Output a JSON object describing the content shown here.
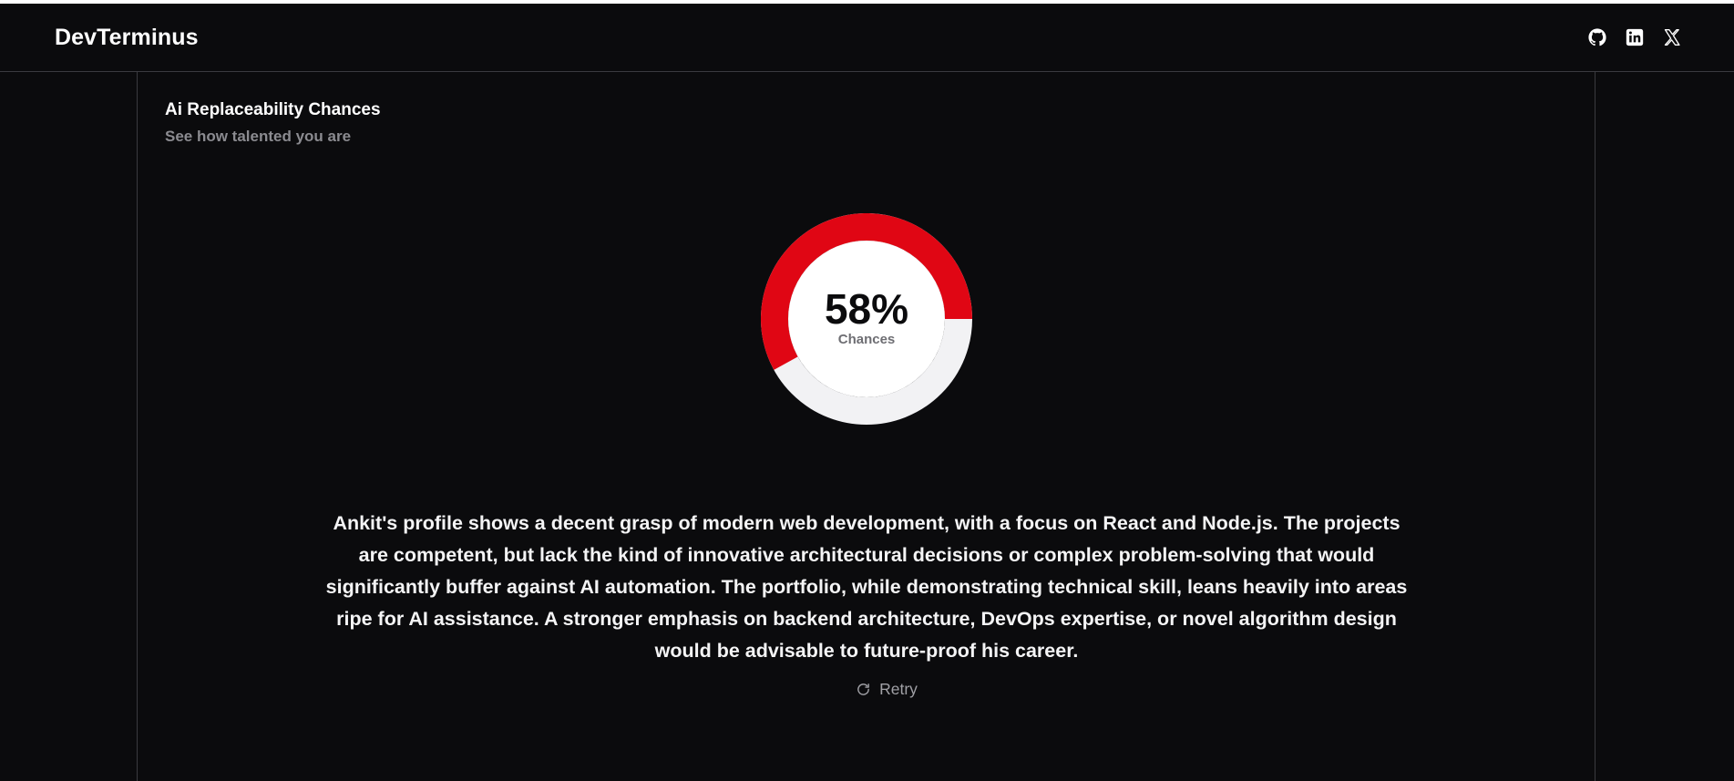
{
  "header": {
    "brand": "DevTerminus",
    "icons": [
      {
        "name": "github-icon"
      },
      {
        "name": "linkedin-icon"
      },
      {
        "name": "x-icon"
      }
    ]
  },
  "section": {
    "title": "Ai Replaceability Chances",
    "subtitle": "See how talented you are"
  },
  "gauge": {
    "value_text": "58%",
    "value": 58,
    "label": "Chances",
    "accent_color": "#e00614",
    "track_color": "#f2f2f4"
  },
  "analysis": {
    "text": "Ankit's profile shows a decent grasp of modern web development, with a focus on React and Node.js. The projects are competent, but lack the kind of innovative architectural decisions or complex problem-solving that would significantly buffer against AI automation. The portfolio, while demonstrating technical skill, leans heavily into areas ripe for AI assistance. A stronger emphasis on backend architecture, DevOps expertise, or novel algorithm design would be advisable to future-proof his career."
  },
  "actions": {
    "retry_label": "Retry",
    "retry_icon": "refresh-icon"
  }
}
